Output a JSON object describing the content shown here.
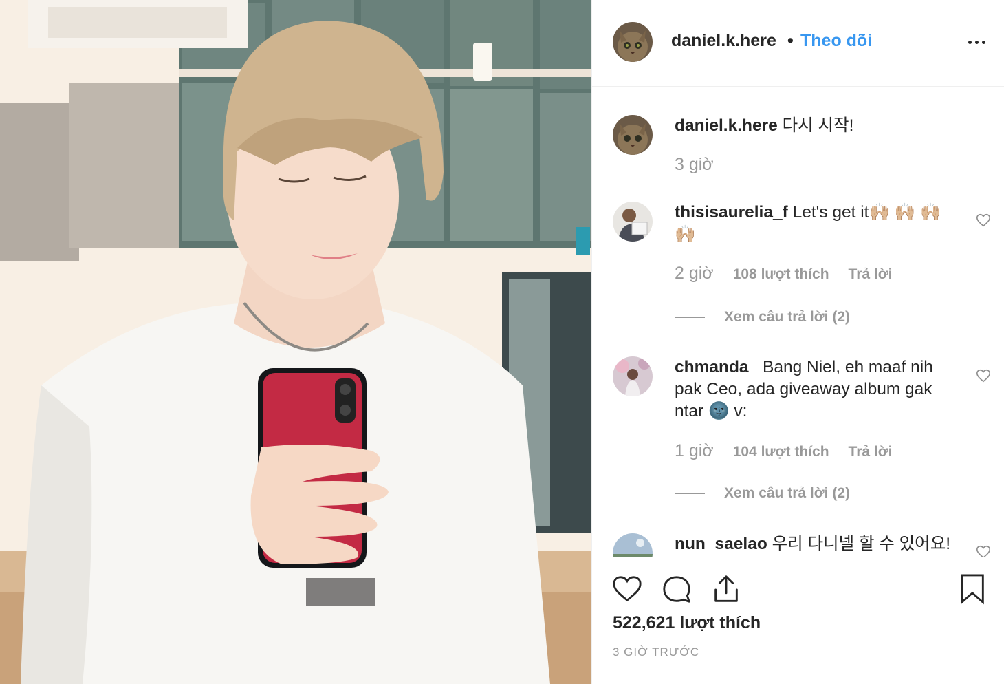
{
  "post": {
    "author": {
      "username": "daniel.k.here",
      "avatar": "cat-photo-avatar"
    },
    "follow_separator": "•",
    "follow_label": "Theo dõi",
    "more_icon": "ellipsis-icon",
    "photo": "selfie-photo",
    "caption": {
      "username": "daniel.k.here",
      "text": "다시 시작!",
      "time": "3 giờ"
    },
    "comments": [
      {
        "username": "thisisaurelia_f",
        "text": "Let's get it🙌🏼 🙌🏼 🙌🏼 🙌🏼",
        "time": "2 giờ",
        "likes": "108 lượt thích",
        "reply_label": "Trả lời",
        "view_replies": "Xem câu trả lời (2)"
      },
      {
        "username": "chmanda_",
        "text": "Bang Niel, eh maaf nih pak Ceo, ada giveaway album gak ntar 🌚 v:",
        "time": "1 giờ",
        "likes": "104 lượt thích",
        "reply_label": "Trả lời",
        "view_replies": "Xem câu trả lời (2)"
      },
      {
        "username": "nun_saelao",
        "text": "우리 다니넬 할 수 있어요!"
      }
    ],
    "likes_total": "522,621 lượt thích",
    "posted_ago": "3 GIỜ TRƯỚC",
    "action_icons": [
      "heart-icon",
      "comment-icon",
      "share-icon",
      "bookmark-icon"
    ],
    "colors": {
      "link_blue": "#3897f0",
      "text": "#262626",
      "muted": "#999999",
      "divider": "#efefef"
    }
  }
}
